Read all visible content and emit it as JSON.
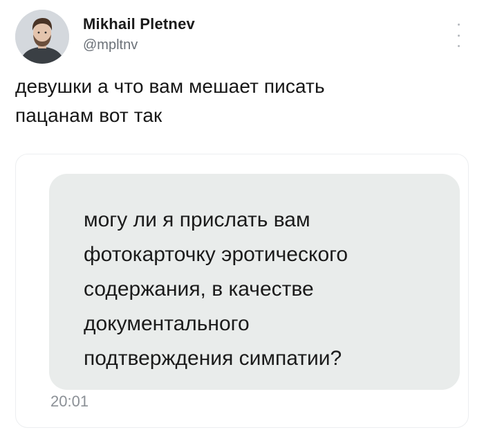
{
  "author": {
    "display_name": "Mikhail Pletnev",
    "handle": "@mpltnv"
  },
  "tweet": {
    "text_lines": [
      "девушки а что вам мешает писать",
      "пацанам вот так"
    ]
  },
  "media": {
    "message_lines": [
      "могу ли я прислать вам",
      "фотокарточку эротического",
      "содержания, в качестве",
      "документального",
      "подтверждения симпатии?"
    ],
    "timestamp": "20:01"
  },
  "icons": {
    "more": "more-vertical-icon",
    "avatar": "user-avatar"
  },
  "colors": {
    "bubble": "#e9eceb",
    "handle": "#6b7178",
    "timestamp": "#8b9096"
  }
}
